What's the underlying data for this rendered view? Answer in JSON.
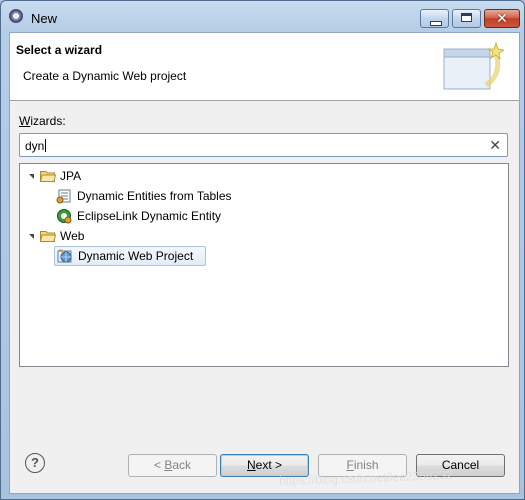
{
  "window": {
    "title": "New"
  },
  "banner": {
    "title": "Select a wizard",
    "description": "Create a Dynamic Web project"
  },
  "filter": {
    "label_prefix": "",
    "label_underlined": "W",
    "label_rest": "izards:",
    "value": "dyn"
  },
  "tree": {
    "groups": [
      {
        "label": "JPA",
        "expanded": true,
        "children": [
          "Dynamic Entities from Tables",
          "EclipseLink Dynamic Entity"
        ]
      },
      {
        "label": "Web",
        "expanded": true,
        "children": [
          "Dynamic Web Project"
        ]
      }
    ],
    "selected": "Dynamic Web Project"
  },
  "buttons": {
    "back": {
      "pre": "< ",
      "mnemonic": "B",
      "post": "ack"
    },
    "next": {
      "pre": "",
      "mnemonic": "N",
      "post": "ext >"
    },
    "finish": {
      "pre": "",
      "mnemonic": "F",
      "post": "inish"
    },
    "cancel": "Cancel"
  },
  "watermark": "https://blog.csdn.net/lee2358232",
  "icons": {
    "title": "eclipse-icon",
    "help": "help-icon",
    "folder": "folder-icon",
    "entity": "entity-icon",
    "web_project": "web-project-icon"
  },
  "colors": {
    "selection": "#e1ecf8",
    "titlebar": "#b5cde6",
    "close": "#c0402a"
  }
}
